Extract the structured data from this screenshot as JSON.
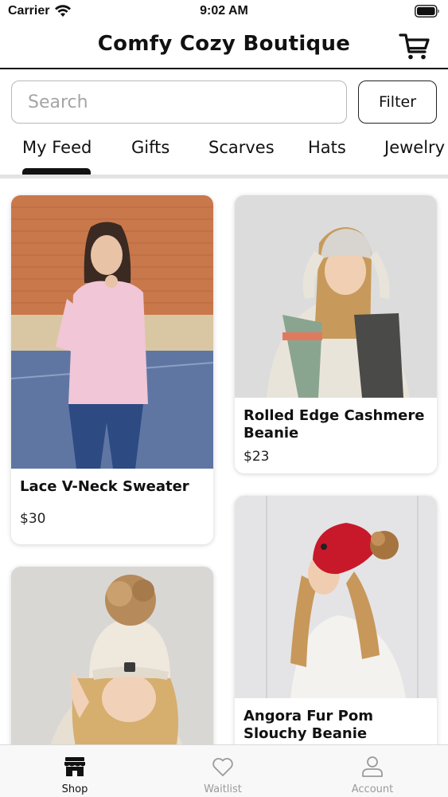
{
  "status_bar": {
    "carrier": "Carrier",
    "time": "9:02 AM",
    "wifi_icon": "wifi-icon",
    "battery_icon": "battery-icon"
  },
  "header": {
    "title": "Comfy Cozy Boutique",
    "cart_icon": "cart-icon"
  },
  "search": {
    "placeholder": "Search",
    "value": ""
  },
  "filter": {
    "label": "Filter"
  },
  "tabs": [
    {
      "label": "My Feed",
      "selected": true
    },
    {
      "label": "Gifts",
      "selected": false
    },
    {
      "label": "Scarves",
      "selected": false
    },
    {
      "label": "Hats",
      "selected": false
    },
    {
      "label": "Jewelry",
      "selected": false
    }
  ],
  "products": [
    {
      "name": "Lace V-Neck Sweater",
      "price": "$30"
    },
    {
      "name": "Rolled Edge Cashmere Beanie",
      "price": "$23"
    },
    {
      "name": "",
      "price": ""
    },
    {
      "name": "Angora Fur Pom Slouchy Beanie",
      "price": ""
    }
  ],
  "tab_bar": {
    "items": [
      {
        "label": "Shop",
        "icon": "storefront-icon",
        "selected": true
      },
      {
        "label": "Waitlist",
        "icon": "heart-icon",
        "selected": false
      },
      {
        "label": "Account",
        "icon": "person-icon",
        "selected": false
      }
    ]
  },
  "colors": {
    "accent": "#111111",
    "inactive": "#9a9a9a",
    "beanie_red": "#c8192b"
  }
}
